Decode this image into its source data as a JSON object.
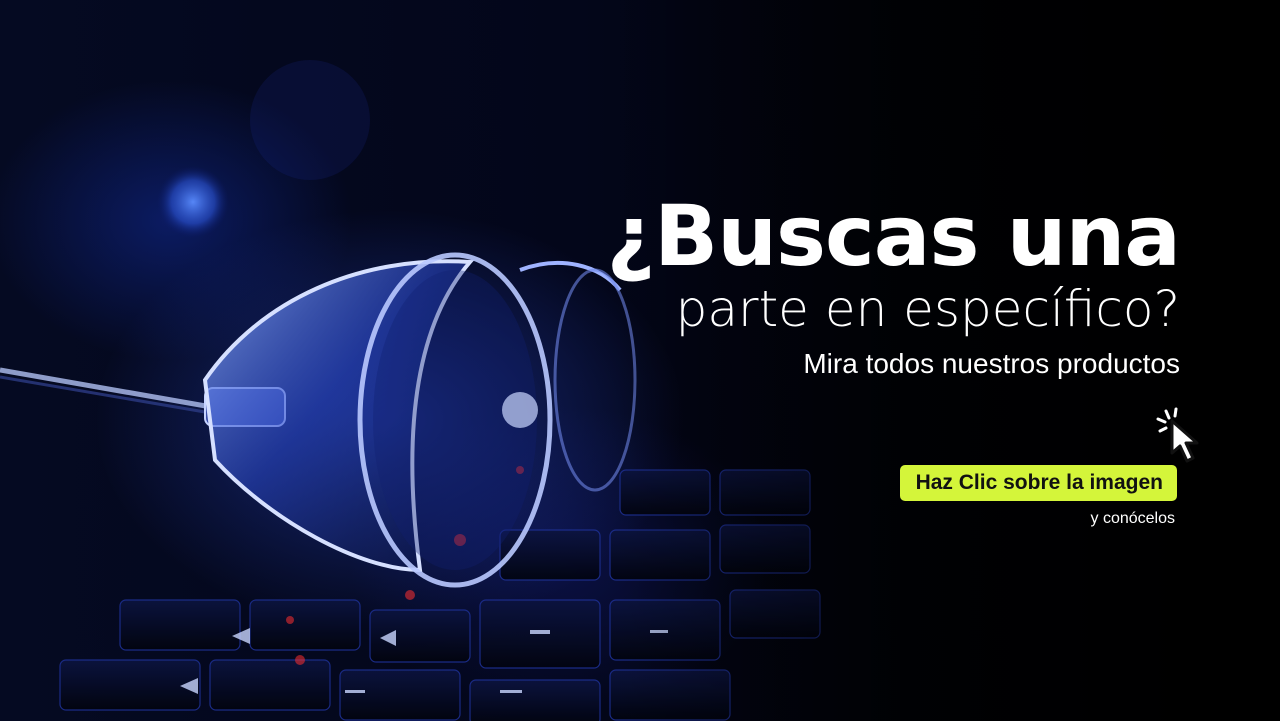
{
  "banner": {
    "headline": "¿Buscas una",
    "subheadline": "parte en específico?",
    "tagline": "Mira todos nuestros productos",
    "cta_label": "Haz Clic sobre la imagen",
    "cta_sublabel": "y conócelos",
    "cursor_icon": "mouse-pointer-click-icon",
    "background_image": "glasses-on-keyboard-photo"
  },
  "colors": {
    "cta_background": "#d4f53a",
    "text": "#ffffff",
    "background": "#000000"
  }
}
